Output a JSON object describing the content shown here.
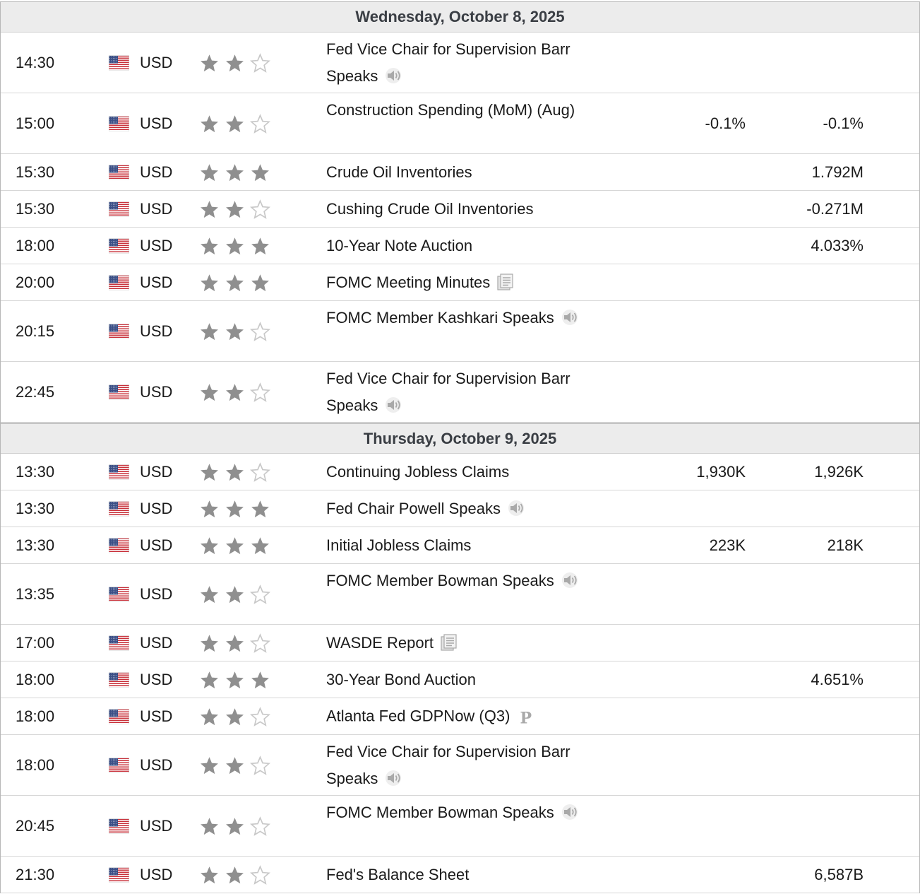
{
  "days": [
    {
      "date": "Wednesday, October 8, 2025",
      "events": [
        {
          "time": "14:30",
          "currency": "USD",
          "stars": 2,
          "event": "Fed Vice Chair for Supervision Barr Speaks",
          "icon": "speaker-icon",
          "actual": "",
          "previous": "",
          "tall": true
        },
        {
          "time": "15:00",
          "currency": "USD",
          "stars": 2,
          "event": "Construction Spending (MoM) (Aug)",
          "icon": "",
          "actual": "-0.1%",
          "previous": "-0.1%",
          "tall": true
        },
        {
          "time": "15:30",
          "currency": "USD",
          "stars": 3,
          "event": "Crude Oil Inventories",
          "icon": "",
          "actual": "",
          "previous": "1.792M",
          "tall": false
        },
        {
          "time": "15:30",
          "currency": "USD",
          "stars": 2,
          "event": "Cushing Crude Oil Inventories",
          "icon": "",
          "actual": "",
          "previous": "-0.271M",
          "tall": false
        },
        {
          "time": "18:00",
          "currency": "USD",
          "stars": 3,
          "event": "10-Year Note Auction",
          "icon": "",
          "actual": "",
          "previous": "4.033%",
          "tall": false
        },
        {
          "time": "20:00",
          "currency": "USD",
          "stars": 3,
          "event": "FOMC Meeting Minutes",
          "icon": "document-icon",
          "actual": "",
          "previous": "",
          "tall": false
        },
        {
          "time": "20:15",
          "currency": "USD",
          "stars": 2,
          "event": "FOMC Member Kashkari Speaks",
          "icon": "speaker-icon",
          "actual": "",
          "previous": "",
          "tall": true
        },
        {
          "time": "22:45",
          "currency": "USD",
          "stars": 2,
          "event": "Fed Vice Chair for Supervision Barr Speaks",
          "icon": "speaker-icon",
          "actual": "",
          "previous": "",
          "tall": true
        }
      ]
    },
    {
      "date": "Thursday, October 9, 2025",
      "events": [
        {
          "time": "13:30",
          "currency": "USD",
          "stars": 2,
          "event": "Continuing Jobless Claims",
          "icon": "",
          "actual": "1,930K",
          "previous": "1,926K",
          "tall": false
        },
        {
          "time": "13:30",
          "currency": "USD",
          "stars": 3,
          "event": "Fed Chair Powell Speaks",
          "icon": "speaker-icon",
          "actual": "",
          "previous": "",
          "tall": false
        },
        {
          "time": "13:30",
          "currency": "USD",
          "stars": 3,
          "event": "Initial Jobless Claims",
          "icon": "",
          "actual": "223K",
          "previous": "218K",
          "tall": false
        },
        {
          "time": "13:35",
          "currency": "USD",
          "stars": 2,
          "event": "FOMC Member Bowman Speaks",
          "icon": "speaker-icon",
          "actual": "",
          "previous": "",
          "tall": true
        },
        {
          "time": "17:00",
          "currency": "USD",
          "stars": 2,
          "event": "WASDE Report",
          "icon": "document-icon",
          "actual": "",
          "previous": "",
          "tall": false
        },
        {
          "time": "18:00",
          "currency": "USD",
          "stars": 3,
          "event": "30-Year Bond Auction",
          "icon": "",
          "actual": "",
          "previous": "4.651%",
          "tall": false
        },
        {
          "time": "18:00",
          "currency": "USD",
          "stars": 2,
          "event": "Atlanta Fed GDPNow (Q3)",
          "icon": "preliminary-icon",
          "icon_text": "P",
          "actual": "",
          "previous": "",
          "tall": false
        },
        {
          "time": "18:00",
          "currency": "USD",
          "stars": 2,
          "event": "Fed Vice Chair for Supervision Barr Speaks",
          "icon": "speaker-icon",
          "actual": "",
          "previous": "",
          "tall": true
        },
        {
          "time": "20:45",
          "currency": "USD",
          "stars": 2,
          "event": "FOMC Member Bowman Speaks",
          "icon": "speaker-icon",
          "actual": "",
          "previous": "",
          "tall": true
        },
        {
          "time": "21:30",
          "currency": "USD",
          "stars": 2,
          "event": "Fed's Balance Sheet",
          "icon": "",
          "actual": "",
          "previous": "6,587B",
          "tall": false
        }
      ]
    }
  ],
  "colors": {
    "star_filled": "#8f8f8f",
    "star_empty": "#c8c8c8",
    "header_bg": "#ececec",
    "icon_gray": "#a9a9a9"
  }
}
